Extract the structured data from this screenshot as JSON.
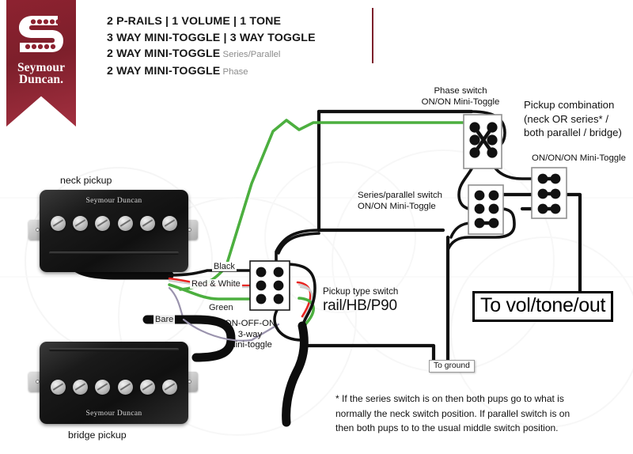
{
  "brand": {
    "name_line1": "Seymour",
    "name_line2": "Duncan.",
    "logo_letter": "S"
  },
  "header": {
    "line1": "2 P-RAILS | 1 VOLUME | 1 TONE",
    "line2": "3 WAY MINI-TOGGLE | 3 WAY TOGGLE",
    "line3_main": "2 WAY MINI-TOGGLE",
    "line3_sub": "Series/Parallel",
    "line4_main": "2 WAY MINI-TOGGLE",
    "line4_sub": "Phase"
  },
  "pickups": {
    "neck_label": "neck pickup",
    "bridge_label": "bridge pickup",
    "brand_text": "Seymour Duncan"
  },
  "wire_labels": {
    "black": "Black",
    "red_white": "Red & White",
    "green": "Green",
    "bare": "Bare"
  },
  "switches": {
    "phase": {
      "title": "Phase switch",
      "subtitle": "ON/ON Mini-Toggle"
    },
    "series_parallel": {
      "title": "Series/parallel switch",
      "subtitle": "ON/ON Mini-Toggle"
    },
    "pickup_combination": {
      "line1": "Pickup combination",
      "line2": "(neck OR series* /",
      "line3": "both parallel / bridge)",
      "subtitle": "ON/ON/ON Mini-Toggle"
    },
    "pickup_type": {
      "title": "Pickup type switch",
      "value": "rail/HB/P90",
      "mode_line1": "ON-OFF-ON",
      "mode_line2": "3-way",
      "mode_line3": "mini-toggle"
    }
  },
  "outputs": {
    "vol_tone_out": "To vol/tone/out",
    "ground": "To ground"
  },
  "footnote": {
    "line1": "* If the series switch is on then both pups go to what is",
    "line2": "normally the neck switch position.  If parallel switch is on",
    "line3": "then both pups to to the usual middle switch position."
  },
  "colors": {
    "brand_red": "#7d1f2b",
    "wire_green": "#4caf3f",
    "wire_red": "#e8221f",
    "wire_black": "#111111",
    "wire_bare": "#9a93ad",
    "wire_white": "#cccccc",
    "switch_body": "#ffffff",
    "switch_border": "#8f8f8f",
    "lug": "#111111"
  }
}
